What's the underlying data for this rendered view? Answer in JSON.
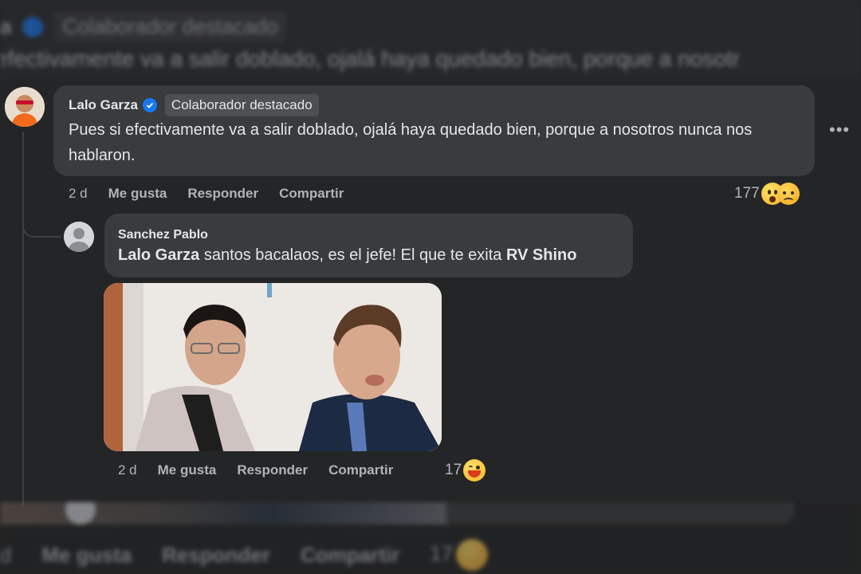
{
  "top_ghost": {
    "name_fragment": "a",
    "badge": "Colaborador destacado",
    "text": "efectivamente va a salir doblado, ojalá haya quedado bien, porque a nosotr"
  },
  "comment": {
    "author": "Lalo Garza",
    "verified": true,
    "badge": "Colaborador destacado",
    "text": "Pues si efectivamente va a salir doblado, ojalá haya quedado bien, porque a nosotros nunca nos hablaron.",
    "more_icon": "ellipsis-icon",
    "time": "2 d",
    "like": "Me gusta",
    "reply": "Responder",
    "share": "Compartir",
    "reaction_count": "177",
    "reactions": [
      "wow-icon",
      "sad-icon"
    ]
  },
  "reply": {
    "author": "Sanchez Pablo",
    "mention1": "Lalo Garza",
    "text_middle": " santos bacalaos, es el jefe! El que te exita ",
    "mention2": "RV Shino",
    "time": "2 d",
    "like": "Me gusta",
    "reply": "Responder",
    "share": "Compartir",
    "reaction_count": "17",
    "reactions": [
      "haha-icon"
    ]
  },
  "bottom_ghost": {
    "time_fragment": "d",
    "like": "Me gusta",
    "reply": "Responder",
    "share": "Compartir",
    "reaction_count": "17"
  },
  "colors": {
    "background": "#242526",
    "bubble": "#3a3b3c",
    "text": "#e4e6eb",
    "secondary": "#b0b3b8",
    "verified": "#1877f2"
  }
}
